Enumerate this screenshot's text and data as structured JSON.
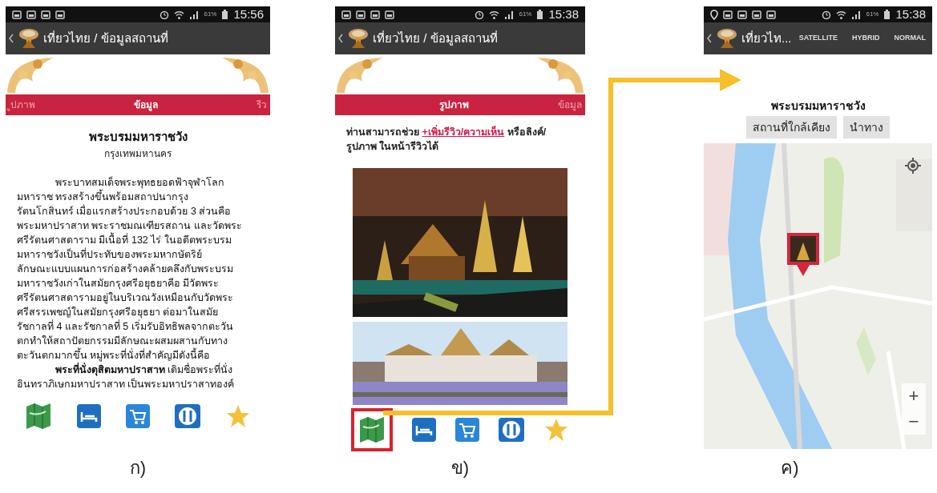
{
  "screens": [
    {
      "kind": "info",
      "status_bar": {
        "battery": "61%",
        "time": "15:56"
      },
      "app_bar": {
        "title": "เที่ยวไทย / ข้อมูลสถานที่"
      },
      "tabs": [
        {
          "label": "ูปภาพ",
          "selected": false
        },
        {
          "label": "ข้อมูล",
          "selected": true
        },
        {
          "label": "รีว",
          "selected": false
        }
      ],
      "place": {
        "name": "พระบรมมหาราชวัง",
        "province": "กรุงเทพมหานคร"
      },
      "paragraphs": [
        {
          "lines": [
            "พระบาทสมเด็จพระพุทธยอดฟ้าจุฬาโลก",
            "มหาราช  ทรงสร้างขึ้นพร้อมสถาปนากรุง",
            "รัตนโกสินทร์ เมื่อแรกสร้างประกอบด้วย 3 ส่วนคือ",
            "พระมหาปราสาท พระราชมณเฑียรสถาน และวัดพระ",
            "ศรีรัตนศาสดาราม มีเนื้อที่ 132 ไร่  ในอดีตพระบรม",
            "มหาราชวังเป็นที่ประทับของพระมหากษัตริย์",
            "ลักษณะแบบแผนการก่อสร้างคล้ายคลึงกับพระบรม",
            "มหาราชวังเก่าในสมัยกรุงศรีอยุธยาคือ มีวัดพระ",
            "ศรีรัตนศาสดารามอยู่ในบริเวณวังเหมือนกับวัดพระ",
            "ศรีสรรเพชญ์ในสมัยกรุงศรีอยุธยา ต่อมาในสมัย",
            "รัชกาลที่ 4 และรัชกาลที่ 5 เริ่มรับอิทธิพลจากตะวัน",
            "ตกทำให้สถาปัตยกรรมมีลักษณะผสมผสานกับทาง",
            "ตะวันตกมากขึ้น หมู่พระที่นั่งที่สำคัญมีดังนี้คือ"
          ]
        },
        {
          "lines": [
            "**พระที่นั่งดุสิตมหาปราสาท**  เดิมชื่อพระที่นั่ง",
            "อินทราภิเษกมหาปราสาท เป็นพระมหาปราสาทองค์"
          ]
        }
      ],
      "icons": [
        {
          "kind": "map",
          "highlighted": false
        },
        {
          "kind": "hotel",
          "highlighted": false
        },
        {
          "kind": "shopping",
          "highlighted": false
        },
        {
          "kind": "restaurant",
          "highlighted": false
        },
        {
          "kind": "favorite",
          "highlighted": false
        }
      ],
      "caption": "ก)"
    },
    {
      "kind": "photos",
      "status_bar": {
        "battery": "61%",
        "time": "15:38"
      },
      "app_bar": {
        "title": "เที่ยวไทย / ข้อมูลสถานที่"
      },
      "tabs": [
        {
          "label": "รูปภาพ",
          "selected": true
        },
        {
          "label": "ข้อมูล",
          "selected": false
        }
      ],
      "notice": "ท่านสามารถช่วย",
      "notice_link": "+เพิ่มรีวิว/ความเห็น",
      "notice_end": " หรือลิงค์/ รูปภาพ ในหน้ารีวิวได้",
      "photos": [
        {
          "kind": "picture"
        },
        {
          "kind": "picture"
        }
      ],
      "icons": [
        {
          "kind": "map",
          "highlighted": true
        },
        {
          "kind": "hotel",
          "highlighted": false
        },
        {
          "kind": "shopping",
          "highlighted": false
        },
        {
          "kind": "restaurant",
          "highlighted": false
        },
        {
          "kind": "favorite",
          "highlighted": false
        }
      ],
      "caption": "ข)"
    },
    {
      "kind": "map",
      "status_bar": {
        "battery": "61%",
        "time": "15:38"
      },
      "app_bar": {
        "title": "เที่ยวไท...",
        "actions": [
          "SATELLITE",
          "HYBRID",
          "NORMAL"
        ]
      },
      "place": {
        "name": "พระบรมมหาราชวัง"
      },
      "buttons": [
        "สถานที่ใกล้เคียง",
        "นำทาง"
      ],
      "zoom": [
        "+",
        "−"
      ],
      "caption": "ค)"
    }
  ]
}
